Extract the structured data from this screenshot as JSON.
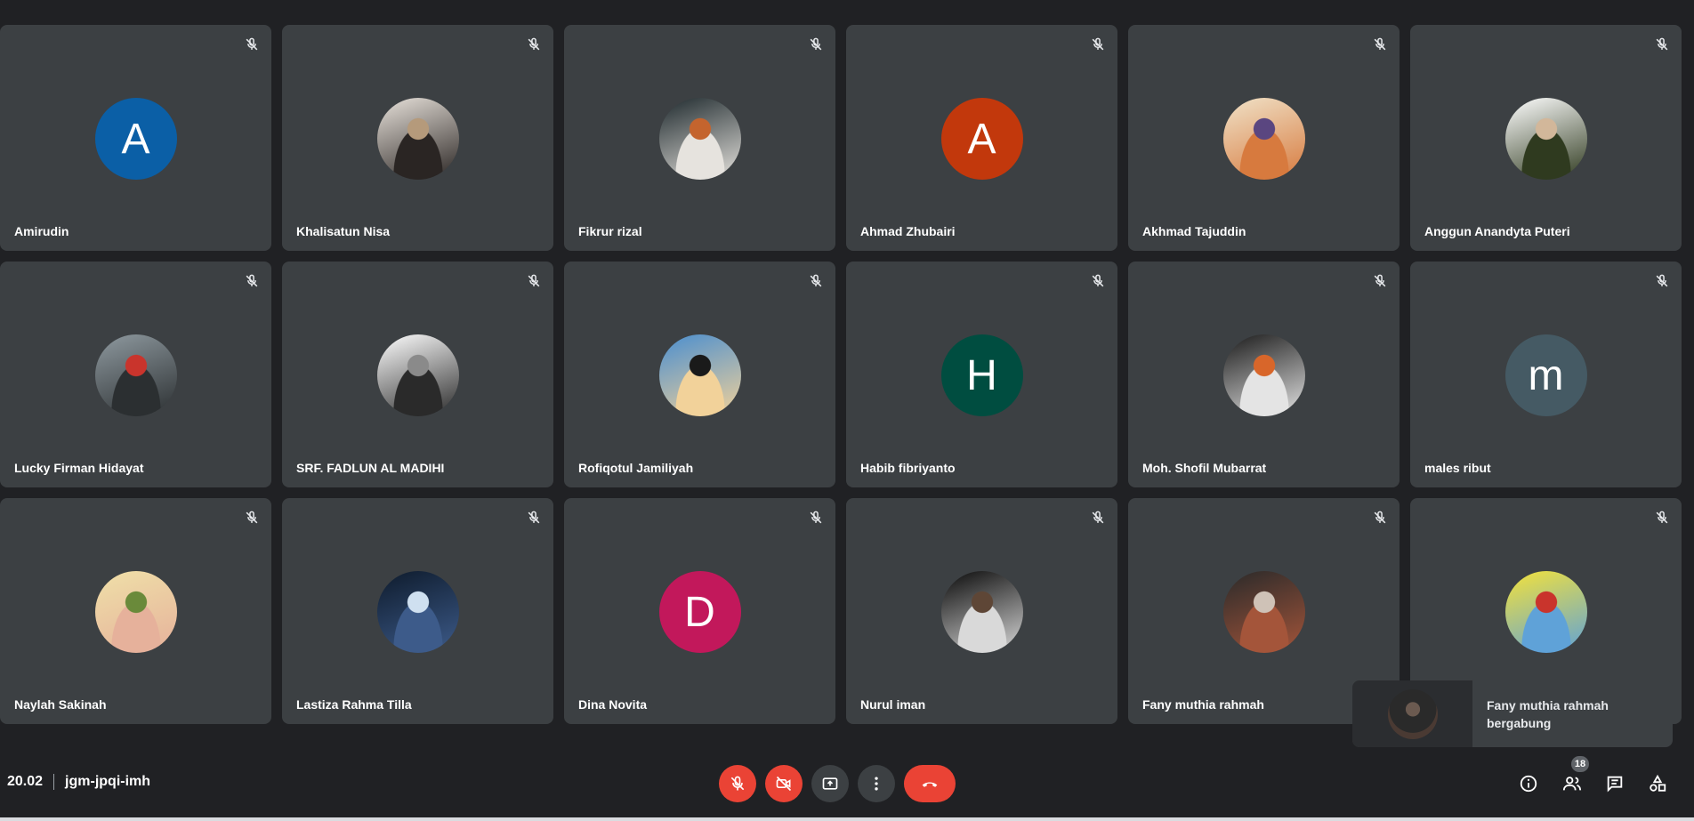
{
  "participants": [
    {
      "name": "Amirudin",
      "avatar": {
        "type": "letter",
        "letter": "A",
        "color": "#0b5fa6"
      }
    },
    {
      "name": "Khalisatun Nisa",
      "avatar": {
        "type": "photo",
        "palette": [
          "#e8e2db",
          "#2a2523",
          "#b59a7b"
        ]
      }
    },
    {
      "name": "Fikrur rizal",
      "avatar": {
        "type": "photo",
        "palette": [
          "#1f2a2e",
          "#e6e3de",
          "#c4642e"
        ]
      }
    },
    {
      "name": "Ahmad Zhubairi",
      "avatar": {
        "type": "letter",
        "letter": "A",
        "color": "#c2380c"
      }
    },
    {
      "name": "Akhmad Tajuddin",
      "avatar": {
        "type": "photo",
        "palette": [
          "#f0e2c8",
          "#d77a3e",
          "#5a4680"
        ]
      }
    },
    {
      "name": "Anggun Anandyta Puteri",
      "avatar": {
        "type": "photo",
        "palette": [
          "#ffffff",
          "#2f3a1f",
          "#d2b79a"
        ]
      }
    },
    {
      "name": "Lucky Firman Hidayat",
      "avatar": {
        "type": "photo",
        "palette": [
          "#8f9aa0",
          "#2b2f31",
          "#c9342c"
        ]
      }
    },
    {
      "name": "SRF. FADLUN AL MADIHI",
      "avatar": {
        "type": "photo",
        "palette": [
          "#ffffff",
          "#2a2a2a",
          "#8a8a8a"
        ]
      }
    },
    {
      "name": "Rofiqotul Jamiliyah",
      "avatar": {
        "type": "photo",
        "palette": [
          "#4a8ecf",
          "#f2d29a",
          "#1a1a1a"
        ]
      }
    },
    {
      "name": "Habib fibriyanto",
      "avatar": {
        "type": "letter",
        "letter": "H",
        "color": "#004d40"
      }
    },
    {
      "name": "Moh. Shofil Mubarrat",
      "avatar": {
        "type": "photo",
        "palette": [
          "#1b1b1b",
          "#e4e4e4",
          "#d8662a"
        ]
      }
    },
    {
      "name": "males ribut",
      "avatar": {
        "type": "letter",
        "letter": "m",
        "color": "#455a64"
      }
    },
    {
      "name": "Naylah Sakinah",
      "avatar": {
        "type": "photo",
        "palette": [
          "#efe0a8",
          "#e6b19b",
          "#6a8a3a"
        ]
      }
    },
    {
      "name": "Lastiza Rahma Tilla",
      "avatar": {
        "type": "photo",
        "palette": [
          "#0e1b2c",
          "#3d5b8a",
          "#cfe0f0"
        ]
      }
    },
    {
      "name": "Dina Novita",
      "avatar": {
        "type": "letter",
        "letter": "D",
        "color": "#c2185b"
      }
    },
    {
      "name": "Nurul iman",
      "avatar": {
        "type": "photo",
        "palette": [
          "#0a0a0a",
          "#d9d9d9",
          "#5e4636"
        ]
      }
    },
    {
      "name": "Fany muthia rahmah",
      "avatar": {
        "type": "photo",
        "palette": [
          "#2a2a2a",
          "#a4553a",
          "#cfc2b7"
        ]
      }
    },
    {
      "name": "",
      "avatar": {
        "type": "photo",
        "palette": [
          "#f4e23a",
          "#5fa2d8",
          "#c9342c"
        ]
      }
    }
  ],
  "toast": {
    "line1": "Fany muthia rahmah",
    "line2": "bergabung"
  },
  "meeting": {
    "time": "20.02",
    "code": "jgm-jpqi-imh"
  },
  "people_count": "18",
  "colors": {
    "background": "#202124",
    "tile": "#3c4043",
    "danger": "#ea4335"
  }
}
